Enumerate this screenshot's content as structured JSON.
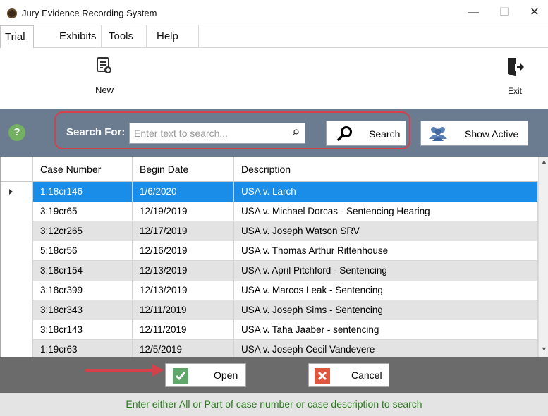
{
  "window": {
    "title": "Jury Evidence Recording System",
    "minimize": "—",
    "maximize": "☐",
    "close": "✕"
  },
  "menu": {
    "tabs": [
      "Trial",
      "Exhibits",
      "Tools",
      "Help"
    ]
  },
  "ribbon": {
    "new_label": "New",
    "exit_label": "Exit"
  },
  "search": {
    "help": "?",
    "label": "Search For:",
    "placeholder": "Enter text to search...",
    "button_label": "Search",
    "show_active_label": "Show Active"
  },
  "grid": {
    "columns": [
      "Case Number",
      "Begin Date",
      "Description"
    ],
    "rows": [
      {
        "case": "1:18cr146",
        "date": "1/6/2020",
        "desc": "USA v. Larch"
      },
      {
        "case": "3:19cr65",
        "date": "12/19/2019",
        "desc": "USA v. Michael Dorcas - Sentencing Hearing"
      },
      {
        "case": "3:12cr265",
        "date": "12/17/2019",
        "desc": "USA v. Joseph Watson SRV"
      },
      {
        "case": "5:18cr56",
        "date": "12/16/2019",
        "desc": "USA v. Thomas Arthur Rittenhouse"
      },
      {
        "case": "3:18cr154",
        "date": "12/13/2019",
        "desc": "USA v. April Pitchford - Sentencing"
      },
      {
        "case": "3:18cr399",
        "date": "12/13/2019",
        "desc": "USA v. Marcos Leak - Sentencing"
      },
      {
        "case": "3:18cr343",
        "date": "12/11/2019",
        "desc": "USA v. Joseph Sims - Sentencing"
      },
      {
        "case": "3:18cr143",
        "date": "12/11/2019",
        "desc": "USA v. Taha Jaaber - sentencing"
      },
      {
        "case": "1:19cr63",
        "date": "12/5/2019",
        "desc": "USA v. Joseph Cecil Vandevere"
      }
    ]
  },
  "actions": {
    "open_label": "Open",
    "cancel_label": "Cancel"
  },
  "status": {
    "message": "Enter either All or Part of case number or case description to search"
  },
  "colors": {
    "selection": "#1a8de9",
    "search_bar": "#6b7b90",
    "status_text": "#2c7a1f",
    "highlight_red": "#d5404a"
  }
}
